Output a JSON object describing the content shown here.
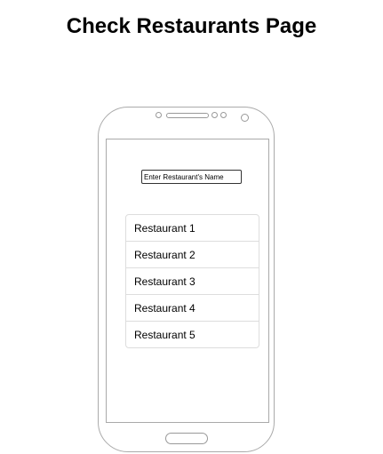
{
  "page": {
    "title": "Check Restaurants Page"
  },
  "search": {
    "placeholder": "Enter Restaurant's Name",
    "value": ""
  },
  "restaurants": [
    {
      "label": "Restaurant 1"
    },
    {
      "label": "Restaurant 2"
    },
    {
      "label": "Restaurant 3"
    },
    {
      "label": "Restaurant 4"
    },
    {
      "label": "Restaurant 5"
    }
  ],
  "colors": {
    "phone_outline": "#aaaaaa",
    "list_border": "#dddddd"
  }
}
